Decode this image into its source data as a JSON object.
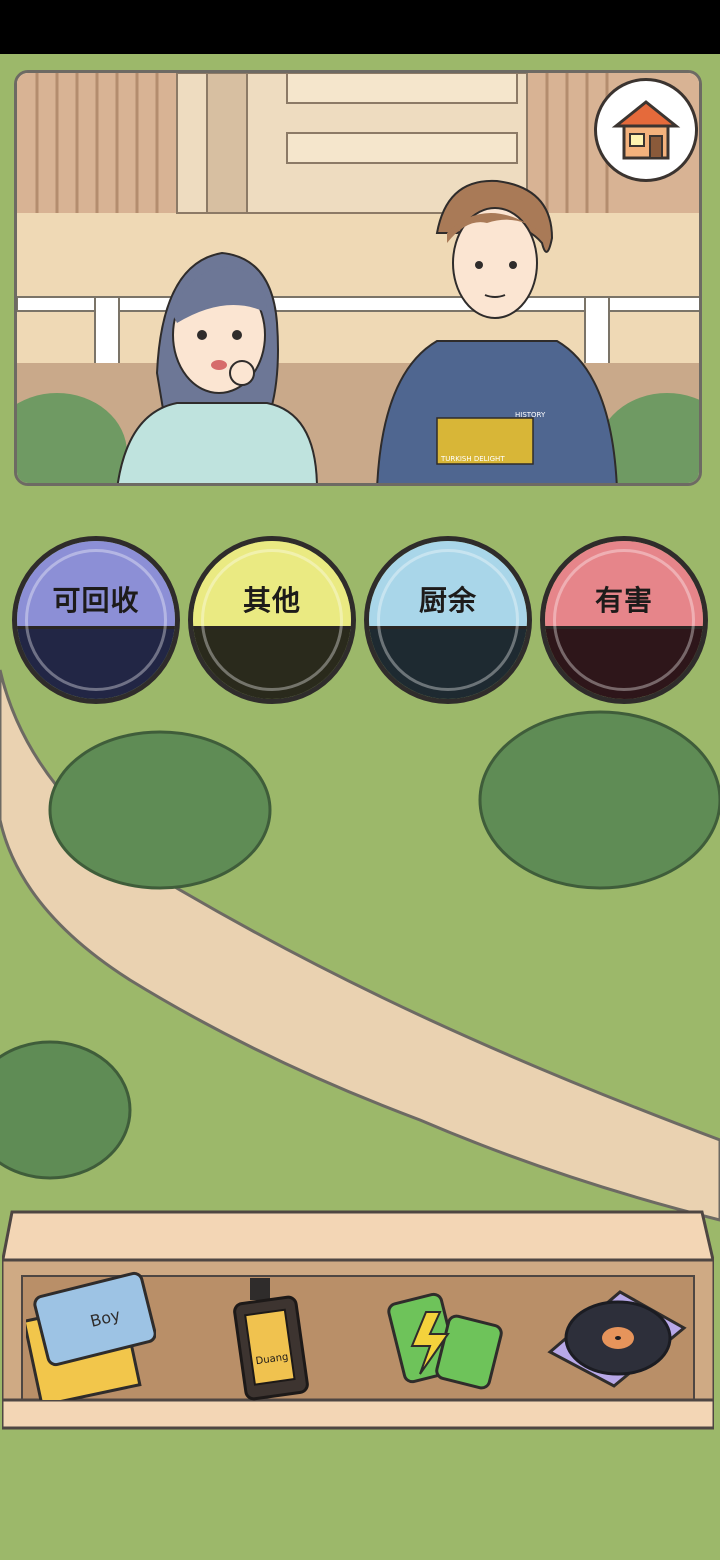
{
  "scene": {
    "characters": [
      "girl",
      "boy"
    ],
    "boy_shirt_text_top": "HISTORY",
    "boy_shirt_text_main": "TURKISH DELIGHT"
  },
  "home_button": {
    "icon": "house-icon"
  },
  "bins": [
    {
      "label": "可回收",
      "top_color": "#8c8fd6",
      "bottom_color": "#222645"
    },
    {
      "label": "其他",
      "top_color": "#eaea82",
      "bottom_color": "#2a2a1c"
    },
    {
      "label": "厨余",
      "top_color": "#a9d6e9",
      "bottom_color": "#1e2a31"
    },
    {
      "label": "有害",
      "top_color": "#e6858a",
      "bottom_color": "#2e161a"
    }
  ],
  "tray_items": [
    {
      "name": "wallet",
      "text": "Boy"
    },
    {
      "name": "lotion-bottle",
      "text": "Duang"
    },
    {
      "name": "battery"
    },
    {
      "name": "vinyl-record"
    }
  ]
}
